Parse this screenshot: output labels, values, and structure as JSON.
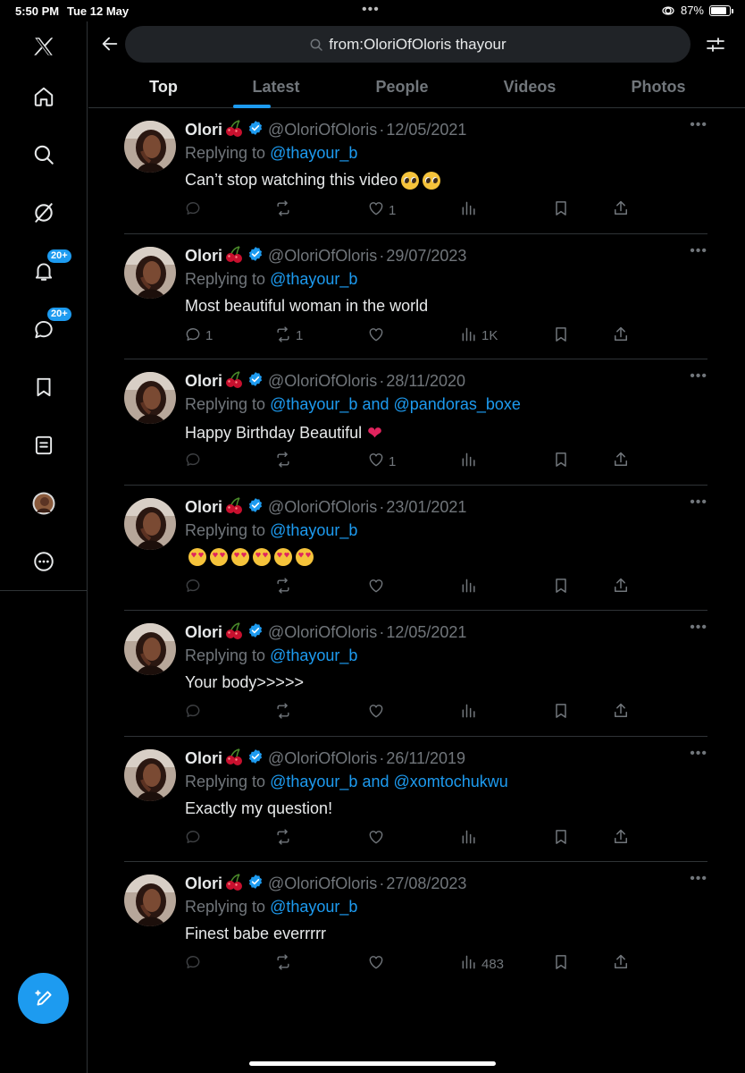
{
  "status_bar": {
    "time": "5:50 PM",
    "date": "Tue 12 May",
    "battery": "87%",
    "battery_level": 0.87
  },
  "sidebar": {
    "items": [
      {
        "icon": "x-logo-icon"
      },
      {
        "icon": "home-icon"
      },
      {
        "icon": "search-icon"
      },
      {
        "icon": "grok-icon"
      },
      {
        "icon": "bell-icon",
        "badge": "20+"
      },
      {
        "icon": "messages-icon",
        "badge": "20+"
      },
      {
        "icon": "bookmark-icon"
      },
      {
        "icon": "lists-icon"
      },
      {
        "icon": "profile-avatar"
      },
      {
        "icon": "more-circle-icon"
      }
    ],
    "compose_icon": "compose-icon"
  },
  "search": {
    "query": "from:OloriOfOloris thayour"
  },
  "tabs": [
    "Top",
    "Latest",
    "People",
    "Videos",
    "Photos"
  ],
  "active_tab": "Top",
  "colors": {
    "accent": "#1d9bf0",
    "background": "#000000",
    "muted": "#71767b",
    "like": "#e0245e"
  },
  "tweets": [
    {
      "name": "Olori",
      "handle": "@OloriOfOloris",
      "sep": "·",
      "date": "12/05/2021",
      "replying_prefix": "Replying to",
      "mention1": "@thayour_b",
      "and": "",
      "mention2": "",
      "text": "Can’t stop watching this video",
      "emoji": "plead2",
      "replies": "",
      "reposts": "",
      "likes": "1",
      "views": ""
    },
    {
      "name": "Olori",
      "handle": "@OloriOfOloris",
      "sep": "·",
      "date": "29/07/2023",
      "replying_prefix": "Replying to",
      "mention1": "@thayour_b",
      "and": "",
      "mention2": "",
      "text": "Most beautiful woman in the world",
      "emoji": "",
      "replies": "1",
      "reposts": "1",
      "likes": "",
      "views": "1K"
    },
    {
      "name": "Olori",
      "handle": "@OloriOfOloris",
      "sep": "·",
      "date": "28/11/2020",
      "replying_prefix": "Replying to",
      "mention1": "@thayour_b",
      "and": "and",
      "mention2": "@pandoras_boxe",
      "text": "Happy Birthday Beautiful",
      "emoji": "heart",
      "replies": "",
      "reposts": "",
      "likes": "1",
      "views": ""
    },
    {
      "name": "Olori",
      "handle": "@OloriOfOloris",
      "sep": "·",
      "date": "23/01/2021",
      "replying_prefix": "Replying to",
      "mention1": "@thayour_b",
      "and": "",
      "mention2": "",
      "text": "",
      "emoji": "hearteyes6",
      "replies": "",
      "reposts": "",
      "likes": "",
      "views": ""
    },
    {
      "name": "Olori",
      "handle": "@OloriOfOloris",
      "sep": "·",
      "date": "12/05/2021",
      "replying_prefix": "Replying to",
      "mention1": "@thayour_b",
      "and": "",
      "mention2": "",
      "text": "Your body>>>>>",
      "emoji": "",
      "replies": "",
      "reposts": "",
      "likes": "",
      "views": ""
    },
    {
      "name": "Olori",
      "handle": "@OloriOfOloris",
      "sep": "·",
      "date": "26/11/2019",
      "replying_prefix": "Replying to",
      "mention1": "@thayour_b",
      "and": "and",
      "mention2": "@xomtochukwu",
      "text": "Exactly my question!",
      "emoji": "",
      "replies": "",
      "reposts": "",
      "likes": "",
      "views": ""
    },
    {
      "name": "Olori",
      "handle": "@OloriOfOloris",
      "sep": "·",
      "date": "27/08/2023",
      "replying_prefix": "Replying to",
      "mention1": "@thayour_b",
      "and": "",
      "mention2": "",
      "text": "Finest babe everrrrr",
      "emoji": "",
      "replies": "",
      "reposts": "",
      "likes": "",
      "views": "483"
    }
  ]
}
